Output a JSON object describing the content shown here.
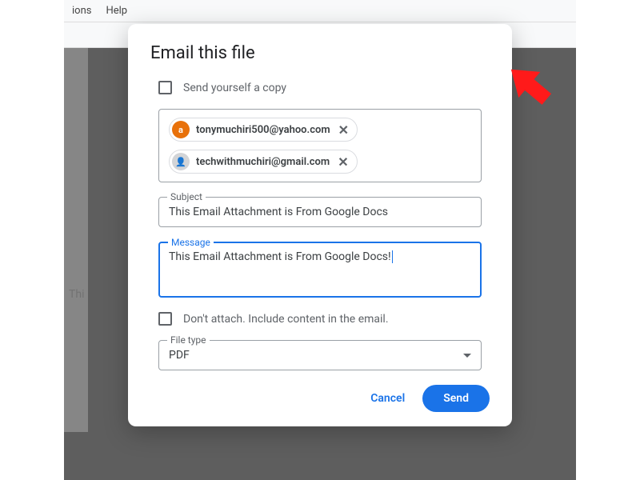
{
  "menubar": {
    "item1": "ions",
    "item2": "Help"
  },
  "dialog": {
    "title": "Email this file",
    "send_copy_label": "Send yourself a copy",
    "recipients": [
      {
        "email": "tonymuchiri500@yahoo.com",
        "initial": "a"
      },
      {
        "email": "techwithmuchiri@gmail.com",
        "initial": "👤"
      }
    ],
    "subject_legend": "Subject",
    "subject_value": "This Email Attachment is From Google Docs",
    "message_legend": "Message",
    "message_value": "This Email Attachment is From Google Docs!",
    "dont_attach_label": "Don't attach. Include content in the email.",
    "filetype_legend": "File type",
    "filetype_value": "PDF",
    "cancel": "Cancel",
    "send": "Send"
  },
  "doc_visible_text": "Thi"
}
